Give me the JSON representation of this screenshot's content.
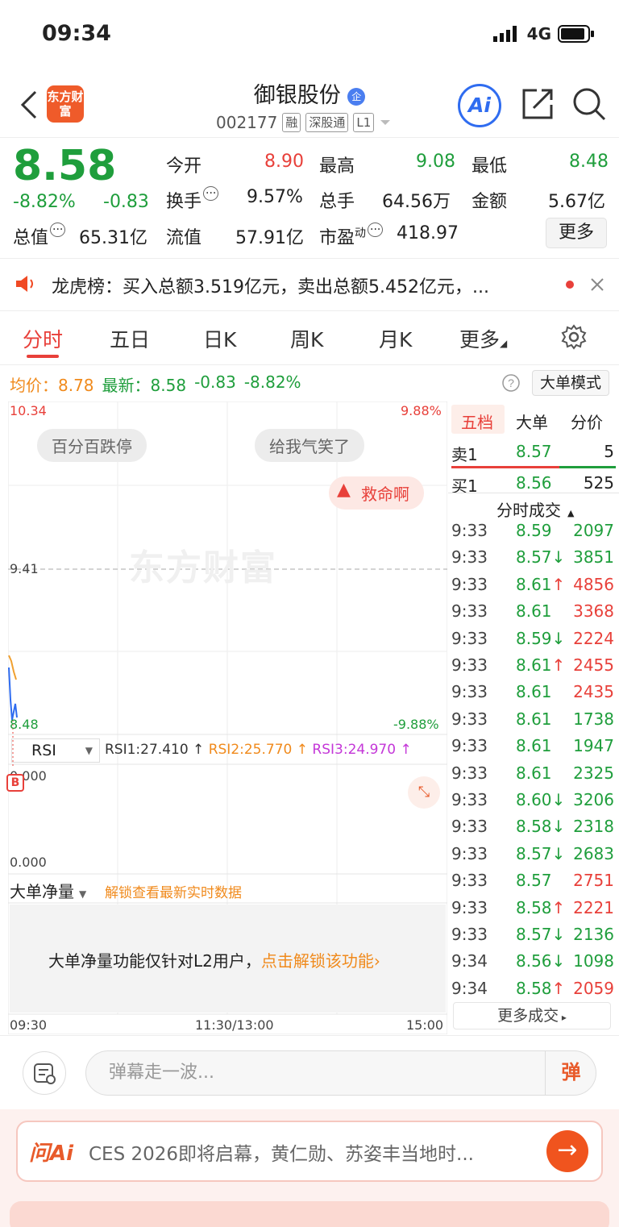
{
  "status_bar": {
    "time": "09:34",
    "network": "4G"
  },
  "header": {
    "logo_text": "东方财富",
    "stock_name": "御银股份",
    "name_badge": "企",
    "code": "002177",
    "tags": [
      "融",
      "深股通",
      "L1"
    ],
    "ai_label": "Ai"
  },
  "quote": {
    "price": "8.58",
    "change_pct": "-8.82%",
    "change": "-0.83",
    "open_label": "今开",
    "open": "8.90",
    "high_label": "最高",
    "high": "9.08",
    "low_label": "最低",
    "low": "8.48",
    "turnover_label": "换手",
    "turnover": "9.57%",
    "volume_label": "总手",
    "volume": "64.56万",
    "amount_label": "金额",
    "amount": "5.67亿",
    "mktcap_label": "总值",
    "mktcap": "65.31亿",
    "float_label": "流值",
    "float": "57.91亿",
    "pe_label": "市盈",
    "pe_sup": "动",
    "pe": "418.97",
    "more_label": "更多"
  },
  "notice": {
    "text": "龙虎榜：买入总额3.519亿元，卖出总额5.452亿元，..."
  },
  "tabs": [
    "分时",
    "五日",
    "日K",
    "周K",
    "月K",
    "更多"
  ],
  "info_row": {
    "avg_label": "均价：",
    "avg": "8.78",
    "latest_label": "最新：",
    "latest": "8.58",
    "change": "-0.83",
    "change_pct": "-8.82%",
    "mode_label": "大单模式"
  },
  "chart": {
    "y_top": "10.34",
    "y_mid": "9.41",
    "y_bottom": "8.48",
    "pct_top": "9.88%",
    "pct_bottom": "-9.88%",
    "bubbles": [
      "百分百跌停",
      "给我气笑了",
      "救命啊"
    ],
    "watermark": "东方财富",
    "x_labels": [
      "09:30",
      "11:30/13:00",
      "15:00"
    ],
    "colors": {
      "price_line": "#2f6cf0",
      "avg_line": "#f0a030"
    }
  },
  "rsi": {
    "selector": "RSI",
    "rsi1": "RSI1:27.410 ↑",
    "rsi2": "RSI2:25.770 ↑",
    "rsi3": "RSI3:24.970 ↑",
    "y_top": "0.000",
    "y_bottom": "0.000",
    "b_marker": "B"
  },
  "bigflow": {
    "selector": "大单净量",
    "unlock_link": "解锁查看最新实时数据",
    "l2_text": "大单净量功能仅针对L2用户，",
    "l2_link": "点击解锁该功能"
  },
  "right_panel": {
    "tabs": [
      "五档",
      "大单",
      "分价"
    ],
    "sell1": {
      "label": "卖1",
      "price": "8.57",
      "vol": "5"
    },
    "buy1": {
      "label": "买1",
      "price": "8.56",
      "vol": "525"
    },
    "trades_title": "分时成交",
    "trades": [
      {
        "t": "9:33",
        "p": "8.59",
        "a": "",
        "v": "2097",
        "vc": "green"
      },
      {
        "t": "9:33",
        "p": "8.57",
        "a": "↓",
        "v": "3851",
        "vc": "green"
      },
      {
        "t": "9:33",
        "p": "8.61",
        "a": "↑",
        "v": "4856",
        "vc": "red"
      },
      {
        "t": "9:33",
        "p": "8.61",
        "a": "",
        "v": "3368",
        "vc": "red"
      },
      {
        "t": "9:33",
        "p": "8.59",
        "a": "↓",
        "v": "2224",
        "vc": "red"
      },
      {
        "t": "9:33",
        "p": "8.61",
        "a": "↑",
        "v": "2455",
        "vc": "red"
      },
      {
        "t": "9:33",
        "p": "8.61",
        "a": "",
        "v": "2435",
        "vc": "red"
      },
      {
        "t": "9:33",
        "p": "8.61",
        "a": "",
        "v": "1738",
        "vc": "green"
      },
      {
        "t": "9:33",
        "p": "8.61",
        "a": "",
        "v": "1947",
        "vc": "green"
      },
      {
        "t": "9:33",
        "p": "8.61",
        "a": "",
        "v": "2325",
        "vc": "green"
      },
      {
        "t": "9:33",
        "p": "8.60",
        "a": "↓",
        "v": "3206",
        "vc": "green"
      },
      {
        "t": "9:33",
        "p": "8.58",
        "a": "↓",
        "v": "2318",
        "vc": "green"
      },
      {
        "t": "9:33",
        "p": "8.57",
        "a": "↓",
        "v": "2683",
        "vc": "green"
      },
      {
        "t": "9:33",
        "p": "8.57",
        "a": "",
        "v": "2751",
        "vc": "red"
      },
      {
        "t": "9:33",
        "p": "8.58",
        "a": "↑",
        "v": "2221",
        "vc": "red"
      },
      {
        "t": "9:33",
        "p": "8.57",
        "a": "↓",
        "v": "2136",
        "vc": "green"
      },
      {
        "t": "9:34",
        "p": "8.56",
        "a": "↓",
        "v": "1098",
        "vc": "green"
      },
      {
        "t": "9:34",
        "p": "8.58",
        "a": "↑",
        "v": "2059",
        "vc": "red"
      }
    ],
    "more_trades": "更多成交"
  },
  "bottom": {
    "danmu_placeholder": "弹幕走一波...",
    "danmu_btn": "弹",
    "ask_logo": "问Ai",
    "ask_text": "CES 2026即将启幕，黄仁勋、苏姿丰当地时..."
  }
}
